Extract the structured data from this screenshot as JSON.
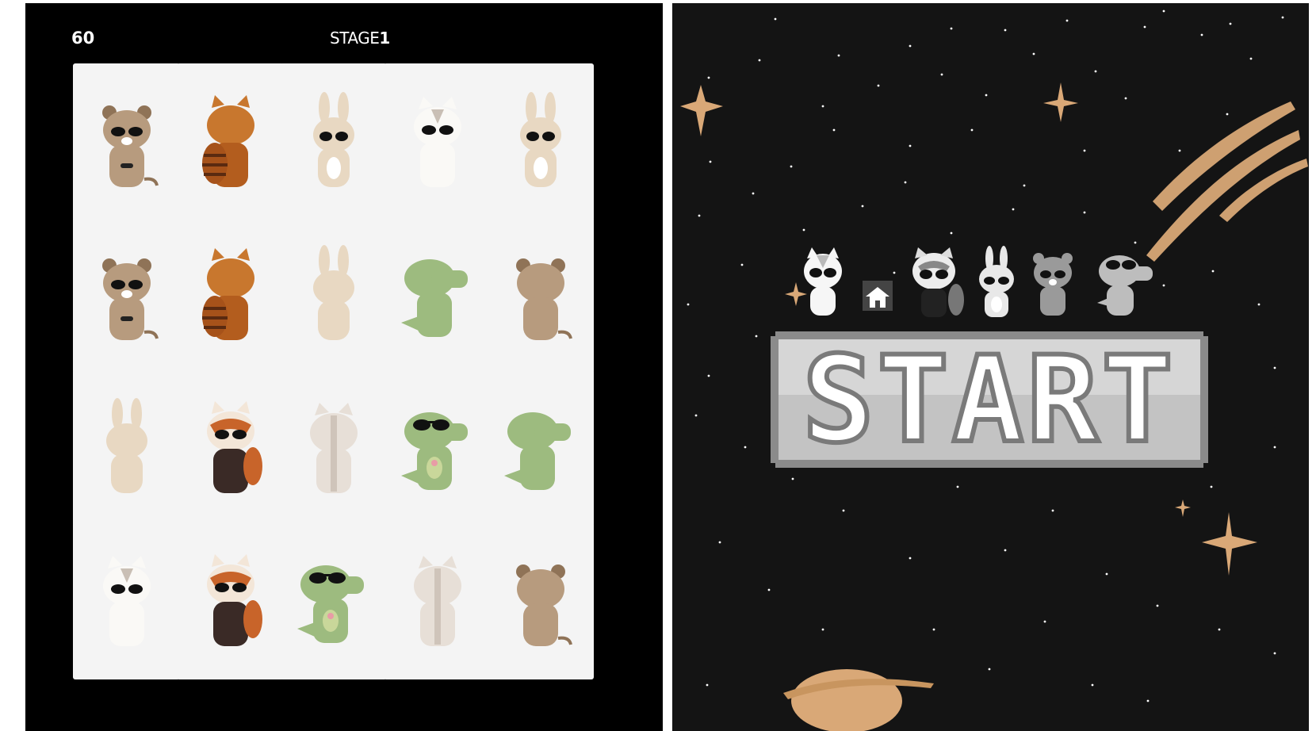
{
  "hud": {
    "score": "60",
    "stage_label": "STAGE",
    "stage_number": "1"
  },
  "cards": [
    {
      "animal": "quokka",
      "side": "front"
    },
    {
      "animal": "red-panda",
      "side": "back"
    },
    {
      "animal": "rabbit",
      "side": "front"
    },
    {
      "animal": "cat",
      "side": "front"
    },
    {
      "animal": "rabbit",
      "side": "front"
    },
    {
      "animal": "quokka",
      "side": "front"
    },
    {
      "animal": "red-panda",
      "side": "back"
    },
    {
      "animal": "rabbit",
      "side": "back"
    },
    {
      "animal": "crocodile",
      "side": "back"
    },
    {
      "animal": "quokka",
      "side": "back"
    },
    {
      "animal": "rabbit",
      "side": "back"
    },
    {
      "animal": "red-panda",
      "side": "front"
    },
    {
      "animal": "cat",
      "side": "back"
    },
    {
      "animal": "crocodile",
      "side": "front"
    },
    {
      "animal": "crocodile",
      "side": "back"
    },
    {
      "animal": "cat",
      "side": "front"
    },
    {
      "animal": "red-panda",
      "side": "front"
    },
    {
      "animal": "crocodile",
      "side": "front"
    },
    {
      "animal": "cat",
      "side": "back"
    },
    {
      "animal": "quokka",
      "side": "back"
    }
  ],
  "start_screen": {
    "start_label": "START",
    "characters": [
      "cat-icon",
      "house-icon",
      "red-panda-icon",
      "rabbit-icon",
      "quokka-icon",
      "crocodile-icon"
    ]
  },
  "colors": {
    "background_left": "#000000",
    "background_right": "#141414",
    "card": "#f4f4f4",
    "accent_gold": "#d9a877"
  }
}
